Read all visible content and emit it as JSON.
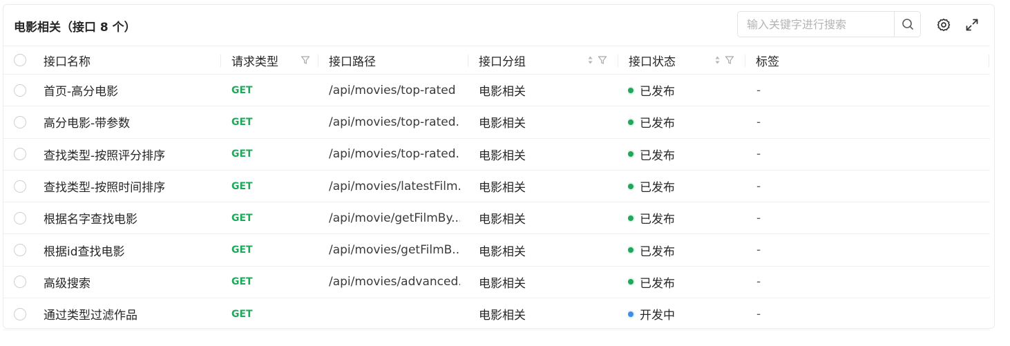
{
  "header": {
    "title": "电影相关（接口 8 个）",
    "search_placeholder": "输入关键字进行搜索",
    "search_value": ""
  },
  "columns": {
    "name": "接口名称",
    "method": "请求类型",
    "path": "接口路径",
    "group": "接口分组",
    "status": "接口状态",
    "tags": "标签"
  },
  "colors": {
    "method_get": "#1ea85a",
    "status_published": "#1ea85a",
    "status_developing": "#3b8eea"
  },
  "rows": [
    {
      "name": "首页-高分电影",
      "method": "GET",
      "path": "/api/movies/top-rated",
      "group": "电影相关",
      "status": "已发布",
      "status_color": "#1ea85a",
      "tags": "-"
    },
    {
      "name": "高分电影-带参数",
      "method": "GET",
      "path": "/api/movies/top-rated...",
      "group": "电影相关",
      "status": "已发布",
      "status_color": "#1ea85a",
      "tags": "-"
    },
    {
      "name": "查找类型-按照评分排序",
      "method": "GET",
      "path": "/api/movies/top-rated...",
      "group": "电影相关",
      "status": "已发布",
      "status_color": "#1ea85a",
      "tags": "-"
    },
    {
      "name": "查找类型-按照时间排序",
      "method": "GET",
      "path": "/api/movies/latestFilm...",
      "group": "电影相关",
      "status": "已发布",
      "status_color": "#1ea85a",
      "tags": "-"
    },
    {
      "name": "根据名字查找电影",
      "method": "GET",
      "path": "/api/movie/getFilmBy...",
      "group": "电影相关",
      "status": "已发布",
      "status_color": "#1ea85a",
      "tags": "-"
    },
    {
      "name": "根据id查找电影",
      "method": "GET",
      "path": "/api/movies/getFilmB...",
      "group": "电影相关",
      "status": "已发布",
      "status_color": "#1ea85a",
      "tags": "-"
    },
    {
      "name": "高级搜索",
      "method": "GET",
      "path": "/api/movies/advanced...",
      "group": "电影相关",
      "status": "已发布",
      "status_color": "#1ea85a",
      "tags": "-"
    },
    {
      "name": "通过类型过滤作品",
      "method": "GET",
      "path": "",
      "group": "电影相关",
      "status": "开发中",
      "status_color": "#3b8eea",
      "tags": "-"
    }
  ]
}
